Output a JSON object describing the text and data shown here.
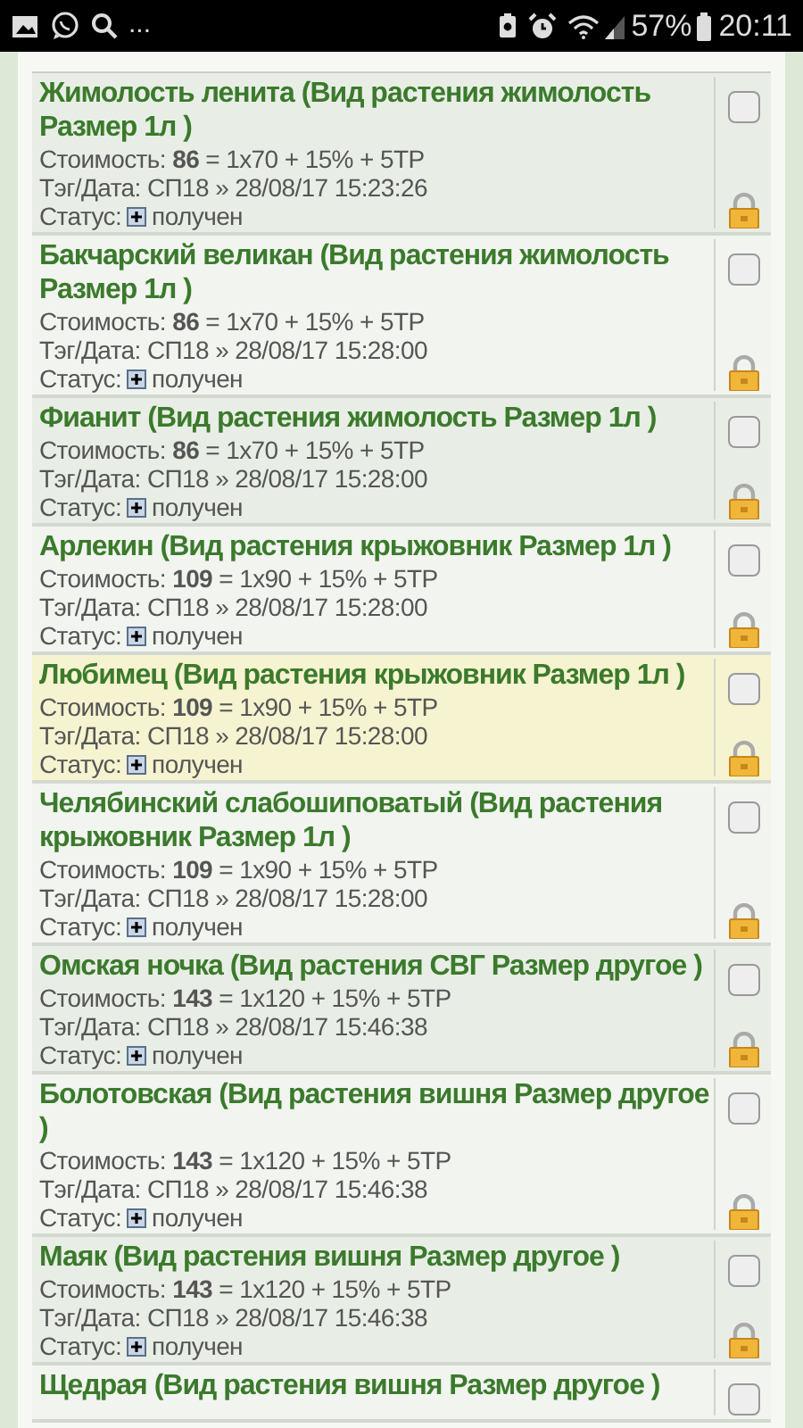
{
  "status_bar": {
    "more": "...",
    "battery": "57%",
    "time": "20:11"
  },
  "orders": [
    {
      "title": "Жимолость ленита (Вид растения жимолость Размер 1л )",
      "cost": "Стоимость: **86** = 1x70 + 15% + 5TP",
      "tag": "Тэг/Дата: СП18 » 28/08/17 15:23:26",
      "status_label": "Статус:",
      "status": "получен",
      "checked": false,
      "highlighted": false
    },
    {
      "title": "Бакчарский великан (Вид растения жимолость Размер 1л )",
      "cost": "Стоимость: **86** = 1x70 + 15% + 5TP",
      "tag": "Тэг/Дата: СП18 » 28/08/17 15:28:00",
      "status_label": "Статус:",
      "status": "получен",
      "checked": false,
      "highlighted": false
    },
    {
      "title": "Фианит (Вид растения жимолость Размер 1л )",
      "cost": "Стоимость: **86** = 1x70 + 15% + 5TP",
      "tag": "Тэг/Дата: СП18 » 28/08/17 15:28:00",
      "status_label": "Статус:",
      "status": "получен",
      "checked": false,
      "highlighted": false
    },
    {
      "title": "Арлекин (Вид растения крыжовник Размер 1л )",
      "cost": "Стоимость: **109** = 1x90 + 15% + 5TP",
      "tag": "Тэг/Дата: СП18 » 28/08/17 15:28:00",
      "status_label": "Статус:",
      "status": "получен",
      "checked": false,
      "highlighted": false
    },
    {
      "title": "Любимец (Вид растения крыжовник Размер 1л )",
      "cost": "Стоимость: **109** = 1x90 + 15% + 5TP",
      "tag": "Тэг/Дата: СП18 » 28/08/17 15:28:00",
      "status_label": "Статус:",
      "status": "получен",
      "checked": false,
      "highlighted": true
    },
    {
      "title": "Челябинский слабошиповатый (Вид растения крыжовник Размер 1л )",
      "cost": "Стоимость: **109** = 1x90 + 15% + 5TP",
      "tag": "Тэг/Дата: СП18 » 28/08/17 15:28:00",
      "status_label": "Статус:",
      "status": "получен",
      "checked": false,
      "highlighted": false
    },
    {
      "title": "Омская ночка (Вид растения СВГ Размер другое )",
      "cost": "Стоимость: **143** = 1x120 + 15% + 5TP",
      "tag": "Тэг/Дата: СП18 » 28/08/17 15:46:38",
      "status_label": "Статус:",
      "status": "получен",
      "checked": false,
      "highlighted": false
    },
    {
      "title": "Болотовская (Вид растения вишня Размер другое )",
      "cost": "Стоимость: **143** = 1x120 + 15% + 5TP",
      "tag": "Тэг/Дата: СП18 » 28/08/17 15:46:38",
      "status_label": "Статус:",
      "status": "получен",
      "checked": false,
      "highlighted": false
    },
    {
      "title": "Маяк (Вид растения вишня Размер другое )",
      "cost": "Стоимость: **143** = 1x120 + 15% + 5TP",
      "tag": "Тэг/Дата: СП18 » 28/08/17 15:46:38",
      "status_label": "Статус:",
      "status": "получен",
      "checked": false,
      "highlighted": false
    },
    {
      "title": "Щедрая (Вид растения вишня Размер другое )",
      "checked": false,
      "highlighted": false
    }
  ]
}
